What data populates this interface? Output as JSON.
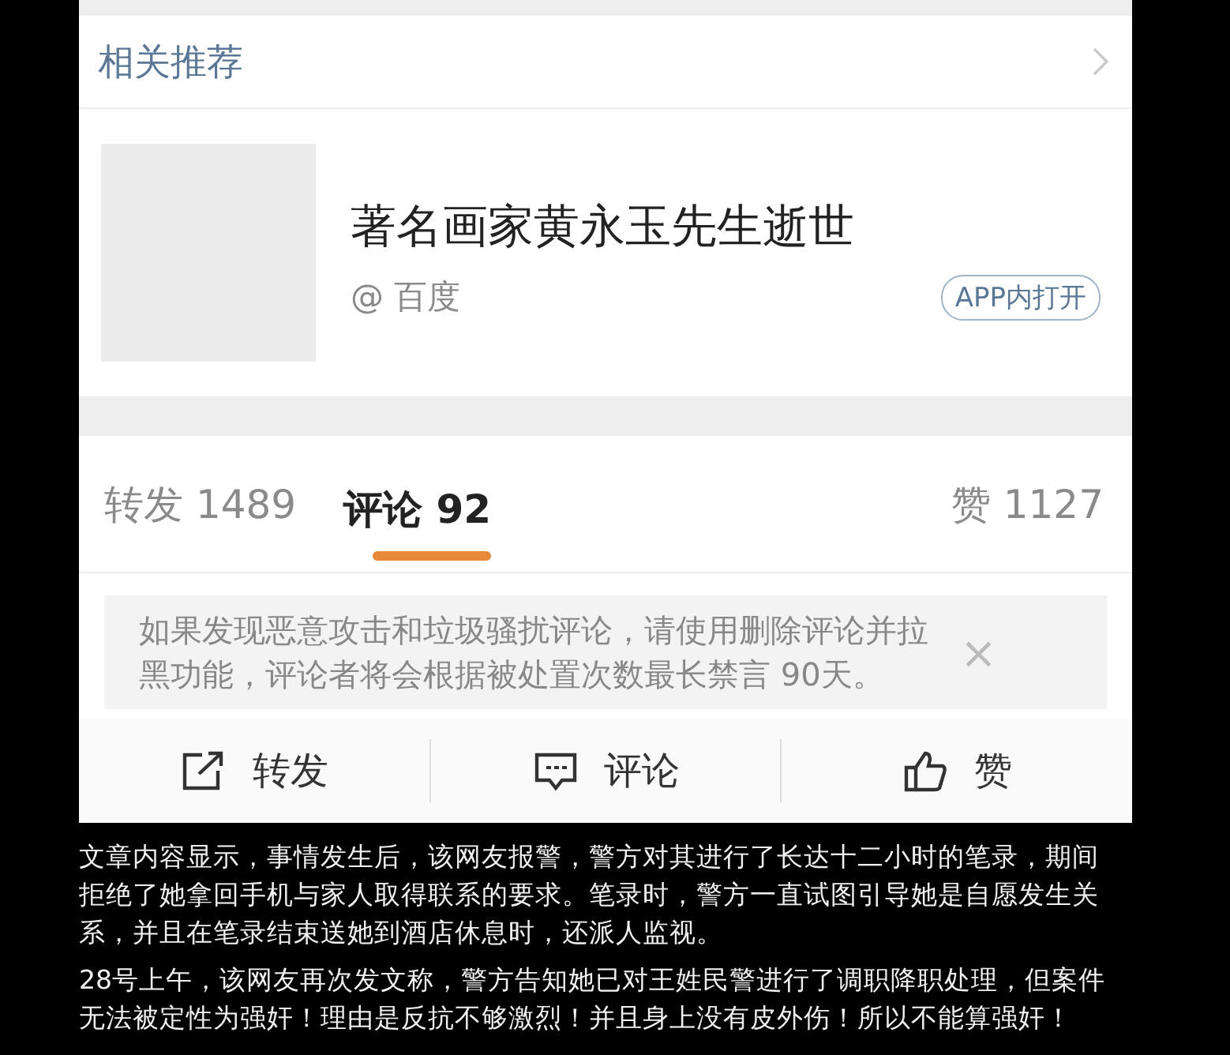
{
  "section_header": {
    "title": "相关推荐"
  },
  "recommendation": {
    "thumbnail": {
      "kind": "placeholder"
    },
    "title": "著名画家黄永玉先生逝世",
    "source": "@ 百度",
    "open_button": "APP内打开"
  },
  "tabs": [
    {
      "label": "转发 1489",
      "selected": false
    },
    {
      "label": "评论 92",
      "selected": true
    },
    {
      "label": "赞 1127",
      "selected": false
    }
  ],
  "notice": {
    "text": "如果发现恶意攻击和垃圾骚扰评论，请使用删除评论并拉黑功能，评论者将会根据被处置次数最长禁言 90天。",
    "close": "×"
  },
  "actions": [
    {
      "kind": "share",
      "label": "转发"
    },
    {
      "kind": "comment",
      "label": "评论"
    },
    {
      "kind": "like",
      "label": "赞"
    }
  ],
  "caption": [
    "文章内容显示，事情发生后，该网友报警，警方对其进行了长达十二小时的笔录，期间拒绝了她拿回手机与家人取得联系的要求。笔录时，警方一直试图引导她是自愿发生关系，并且在笔录结束送她到酒店休息时，还派人监视。",
    "28号上午，该网友再次发文称，警方告知她已对王姓民警进行了调职降职处理，但案件无法被定性为强奸！理由是反抗不够激烈！并且身上没有皮外伤！所以不能算强奸！"
  ]
}
